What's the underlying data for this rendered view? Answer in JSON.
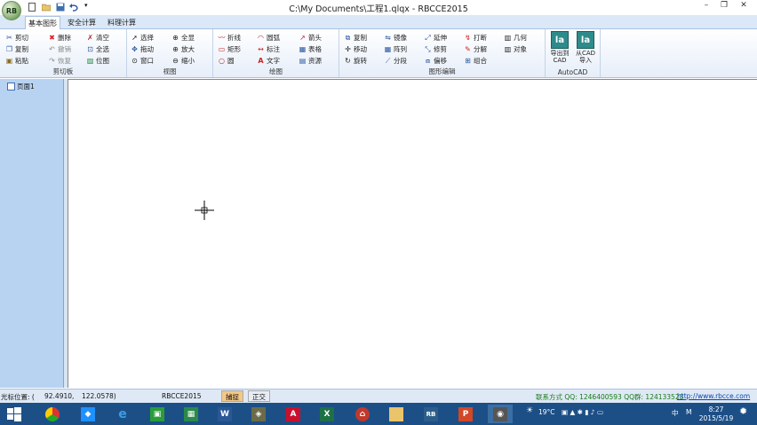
{
  "window": {
    "title": "C:\\My Documents\\工程1.qlqx - RBCCE2015",
    "logo_text": "RB"
  },
  "tabs": [
    "基本图形",
    "安全计算",
    "料理计算"
  ],
  "ribbon": {
    "clipboard": {
      "label": "剪切板",
      "items": [
        "剪切",
        "删除",
        "清空",
        "复制",
        "撤销",
        "全选",
        "粘贴",
        "恢复",
        "位图"
      ]
    },
    "view": {
      "label": "视图",
      "items": [
        "选择",
        "全显",
        "拖动",
        "放大",
        "窗口",
        "缩小"
      ]
    },
    "draw": {
      "label": "绘图",
      "items": [
        "折线",
        "圆弧",
        "箭头",
        "矩形",
        "标注",
        "表格",
        "圆",
        "文字",
        "资源"
      ]
    },
    "edit": {
      "label": "图形编辑",
      "items": [
        "复制",
        "镜像",
        "延伸",
        "打断",
        "几何",
        "移动",
        "阵列",
        "修剪",
        "分解",
        "对象",
        "旋转",
        "分段",
        "偏移",
        "组合"
      ]
    },
    "autocad": {
      "label": "AutoCAD",
      "export_label": "导出到CAD",
      "import_label": "从CAD导入"
    }
  },
  "sidebar": {
    "tree_item": "页面1"
  },
  "status": {
    "coord_label": "光标位置: (",
    "coord_x": "92.4910,",
    "coord_y": "122.0578)",
    "app": "RBCCE2015",
    "snap": "捕捉",
    "ortho": "正交",
    "contact": "联系方式  QQ: 1246400593  QQ群: 124133523",
    "url": "http://www.rbcce.com"
  },
  "taskbar": {
    "temperature": "19°C",
    "ime": "中",
    "ime_mode": "M",
    "time": "8:27",
    "date": "2015/5/19"
  },
  "colors": {
    "accent": "#1d4f87",
    "ribbon_tab": "#dbe8f7",
    "sidebar": "#b8d3f2",
    "link": "#0645ad",
    "contact": "#157a12"
  }
}
